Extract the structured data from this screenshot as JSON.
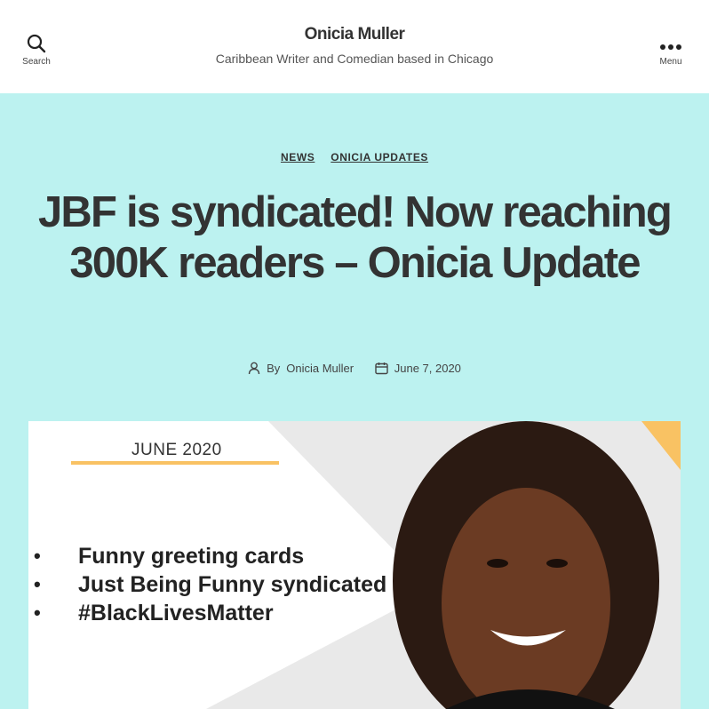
{
  "header": {
    "search_label": "Search",
    "menu_label": "Menu",
    "site_title": "Onicia Muller",
    "site_description": "Caribbean Writer and Comedian based in Chicago"
  },
  "post": {
    "categories": [
      "NEWS",
      "ONICIA UPDATES"
    ],
    "title": "JBF is syndicated! Now reaching 300K readers – Onicia Update",
    "author_prefix": "By",
    "author": "Onicia Muller",
    "date": "June 7, 2020"
  },
  "featured_image": {
    "date_text": "JUNE 2020",
    "bullets": [
      "Funny greeting cards",
      "Just Being Funny syndicated",
      "#BlackLivesMatter"
    ]
  },
  "colors": {
    "hero_background": "#bcf2f0",
    "accent_orange": "#f9c263",
    "text": "#333333"
  },
  "icons": {
    "search": "search-icon",
    "menu": "more-dots-icon",
    "author": "person-icon",
    "date": "calendar-icon"
  }
}
